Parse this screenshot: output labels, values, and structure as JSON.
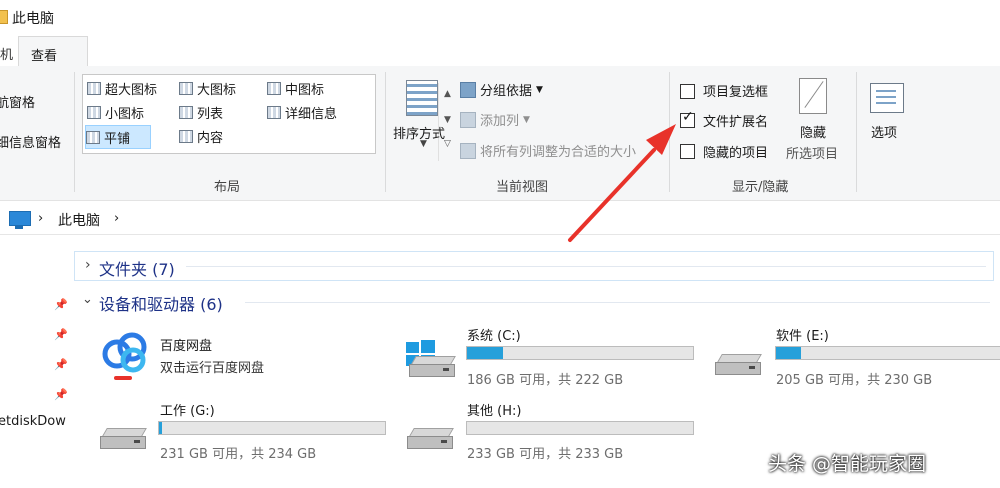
{
  "window": {
    "title": "此电脑"
  },
  "tabs": {
    "left_partial": "机",
    "view": "查看"
  },
  "panes": {
    "nav_pane": "航窗格",
    "details_pane": "细信息窗格"
  },
  "layout": {
    "items": [
      {
        "label": "超大图标",
        "icon": "extra-large-icons-icon"
      },
      {
        "label": "大图标",
        "icon": "large-icons-icon"
      },
      {
        "label": "中图标",
        "icon": "medium-icons-icon"
      },
      {
        "label": "小图标",
        "icon": "small-icons-icon"
      },
      {
        "label": "列表",
        "icon": "list-icon"
      },
      {
        "label": "详细信息",
        "icon": "details-icon"
      },
      {
        "label": "平铺",
        "icon": "tiles-icon"
      },
      {
        "label": "内容",
        "icon": "content-icon"
      }
    ],
    "selected": "平铺",
    "group_label": "布局"
  },
  "current_view": {
    "sort_label": "排序方式",
    "group_by": "分组依据",
    "add_columns": "添加列",
    "size_all_columns": "将所有列调整为合适的大小",
    "group_label": "当前视图"
  },
  "show_hide": {
    "item_checkboxes": {
      "label": "项目复选框",
      "checked": false
    },
    "file_extensions": {
      "label": "文件扩展名",
      "checked": true
    },
    "hidden_items": {
      "label": "隐藏的项目",
      "checked": false
    },
    "hide_button": "隐藏",
    "hide_button_sub": "所选项目",
    "group_label": "显示/隐藏"
  },
  "options_button": "选项",
  "address": {
    "sep": "›",
    "location": "此电脑"
  },
  "nav_strip": {
    "partial_text": "etdiskDow"
  },
  "groups": {
    "folders": "文件夹 (7)",
    "devices": "设备和驱动器 (6)"
  },
  "drives": [
    {
      "name": "百度网盘",
      "sub": "双击运行百度网盘"
    },
    {
      "name": "系统 (C:)",
      "free": "186 GB 可用，共 222 GB",
      "used_fraction": 0.16
    },
    {
      "name": "软件 (E:)",
      "free": "205 GB 可用，共 230 GB",
      "used_fraction": 0.11
    },
    {
      "name": "工作 (G:)",
      "free": "231 GB 可用，共 234 GB",
      "used_fraction": 0.013
    },
    {
      "name": "其他 (H:)",
      "free": "233 GB 可用，共 233 GB",
      "used_fraction": 0.0
    }
  ],
  "watermark": "头条 @智能玩家圈",
  "colors": {
    "accent": "#26a0da",
    "arrow": "#e8322a",
    "group_header": "#1e3287"
  }
}
